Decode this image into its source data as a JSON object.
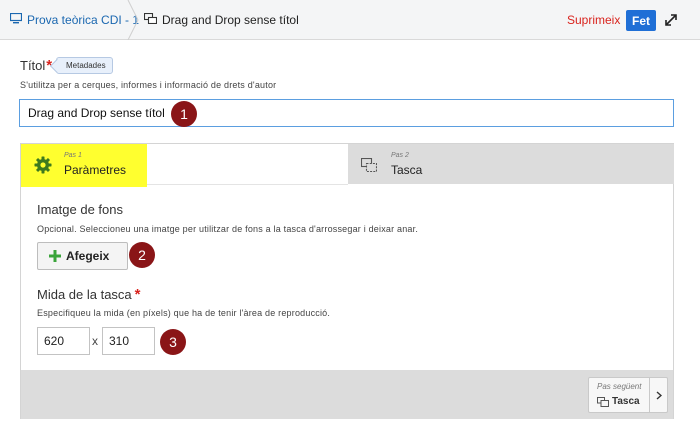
{
  "header": {
    "breadcrumb_parent": "Prova teòrica CDI - 1",
    "breadcrumb_current": "Drag and Drop sense títol",
    "delete_label": "Suprimeix",
    "done_label": "Fet",
    "parent_icon": "monitor-icon",
    "current_icon": "drag-drop-icon",
    "expand_icon": "expand-icon"
  },
  "title_field": {
    "label": "Títol",
    "required_mark": "*",
    "metadata_tag": "Metadades",
    "help": "S'utilitza per a cerques, informes i informació de drets d'autor",
    "value": "Drag and Drop sense títol"
  },
  "wizard": {
    "tabs": [
      {
        "step": "Pas 1",
        "label": "Paràmetres",
        "icon": "gear-icon",
        "active": true
      },
      {
        "step": "Pas 2",
        "label": "Tasca",
        "icon": "drag-drop-icon",
        "active": false
      }
    ],
    "background_image": {
      "title": "Imatge de fons",
      "help": "Opcional. Seleccioneu una imatge per utilitzar de fons a la tasca d'arrossegar i deixar anar.",
      "add_label": "Afegeix",
      "add_icon": "plus-icon"
    },
    "task_size": {
      "title": "Mida de la tasca",
      "required_mark": "*",
      "help": "Especifiqueu la mida (en píxels) que ha de tenir l'àrea de reproducció.",
      "width": "620",
      "separator": "x",
      "height": "310"
    },
    "next": {
      "step": "Pas següent",
      "label": "Tasca",
      "icon": "drag-drop-icon",
      "arrow_icon": "chevron-right-icon"
    }
  },
  "markers": [
    "1",
    "2",
    "3"
  ],
  "colors": {
    "accent": "#1f6fd6",
    "danger": "#d9231d",
    "highlight": "#ffff2f",
    "marker": "#8a1517",
    "gear": "#3e7a1e"
  }
}
